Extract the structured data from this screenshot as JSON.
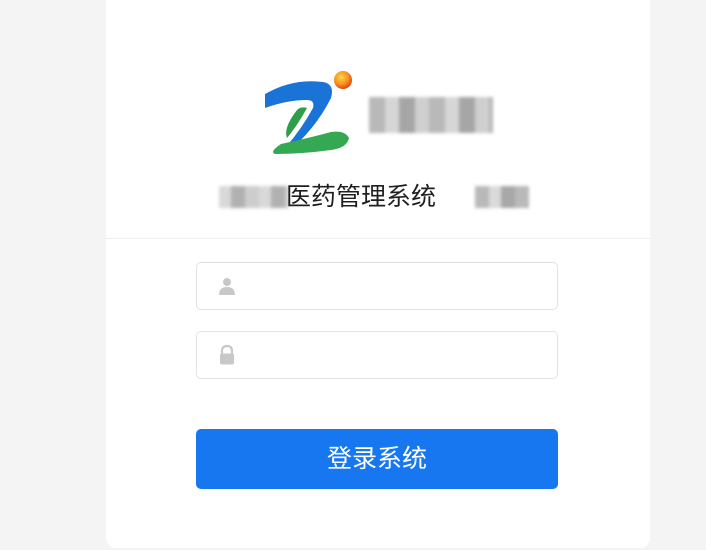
{
  "header": {
    "title": "医药管理系统"
  },
  "form": {
    "username": {
      "value": "",
      "placeholder": ""
    },
    "password": {
      "value": "",
      "placeholder": ""
    },
    "submit_label": "登录系统"
  },
  "icons": {
    "logo": "brand-logo",
    "username": "user-icon",
    "password": "lock-icon"
  },
  "colors": {
    "primary": "#1677f0",
    "logo_blue": "#1a73d6",
    "logo_green": "#34a853",
    "logo_orange": "#f7931e"
  }
}
